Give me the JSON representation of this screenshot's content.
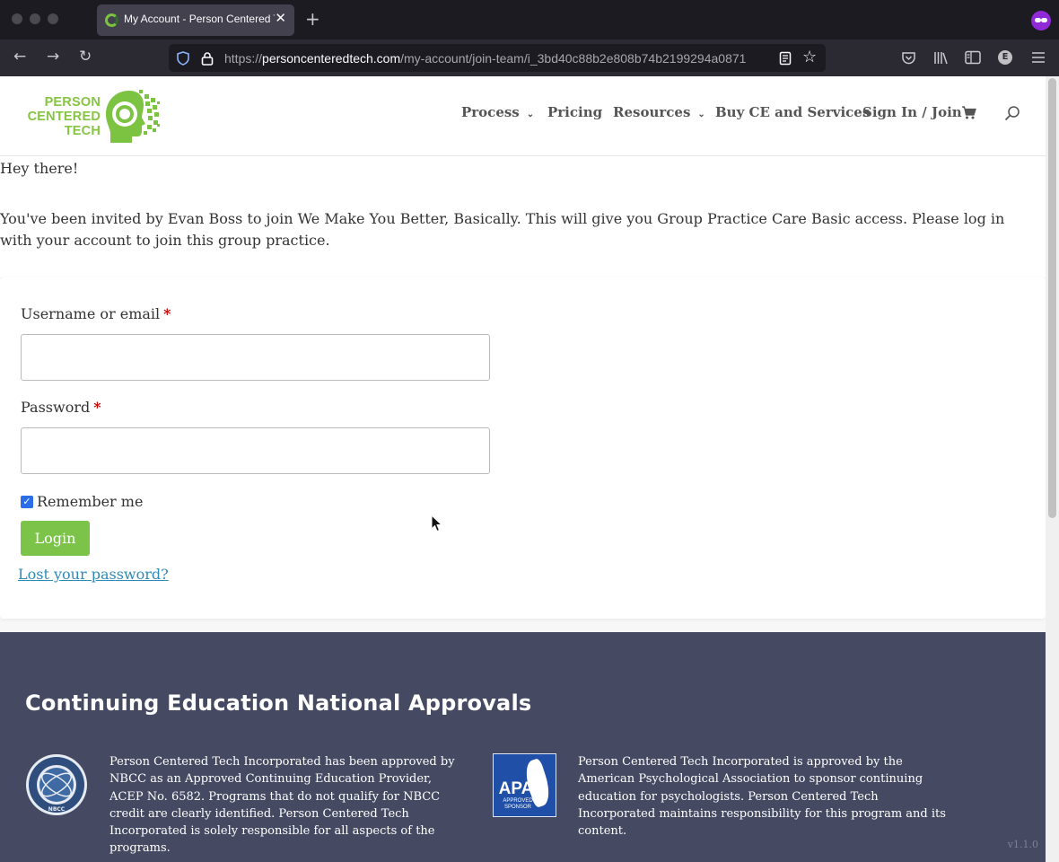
{
  "browser": {
    "tab_title": "My Account - Person Centered Tech",
    "tab_close": "✕",
    "new_tab": "+",
    "url_prefix": "https://",
    "url_host": "personcenteredtech.com",
    "url_path": "/my-account/join-team/i_3bd40c88b2e808b74b2199294a0871",
    "extension_letter": "E"
  },
  "site": {
    "logo_lines": [
      "PERSON",
      "CENTERED",
      "TECH"
    ],
    "brand_color": "#86c542",
    "nav": {
      "process": "Process",
      "pricing": "Pricing",
      "resources": "Resources",
      "buy": "Buy CE and Services",
      "signin": "Sign In / Join"
    }
  },
  "content": {
    "greeting": "Hey there!",
    "invite": "You've been invited by Evan Boss to join We Make You Better, Basically. This will give you Group Practice Care Basic access. Please log in with your account to join this group practice."
  },
  "form": {
    "username_label": "Username or email",
    "password_label": "Password",
    "required_mark": "*",
    "username_value": "",
    "password_value": "",
    "remember_label": "Remember me",
    "remember_checked": true,
    "login_label": "Login",
    "lost_password_label": "Lost your password?"
  },
  "footer": {
    "title": "Continuing Education National Approvals",
    "nbcc_text": "Person Centered Tech Incorporated has been approved by NBCC as an Approved Continuing Education Provider, ACEP No. 6582. Programs that do not qualify for NBCC credit are clearly identified. Person Centered Tech Incorporated is solely responsible for all aspects of the programs.",
    "apa_text": "Person Centered Tech Incorporated is approved by the American Psychological Association to sponsor continuing education for psychologists. Person Centered Tech Incorporated maintains responsibility for this program and its content.",
    "apa_badge_label": "APA",
    "apa_badge_sub": "APPROVED SPONSOR",
    "nbcc_badge_label": "NBCC",
    "version": "v1.1.0"
  }
}
